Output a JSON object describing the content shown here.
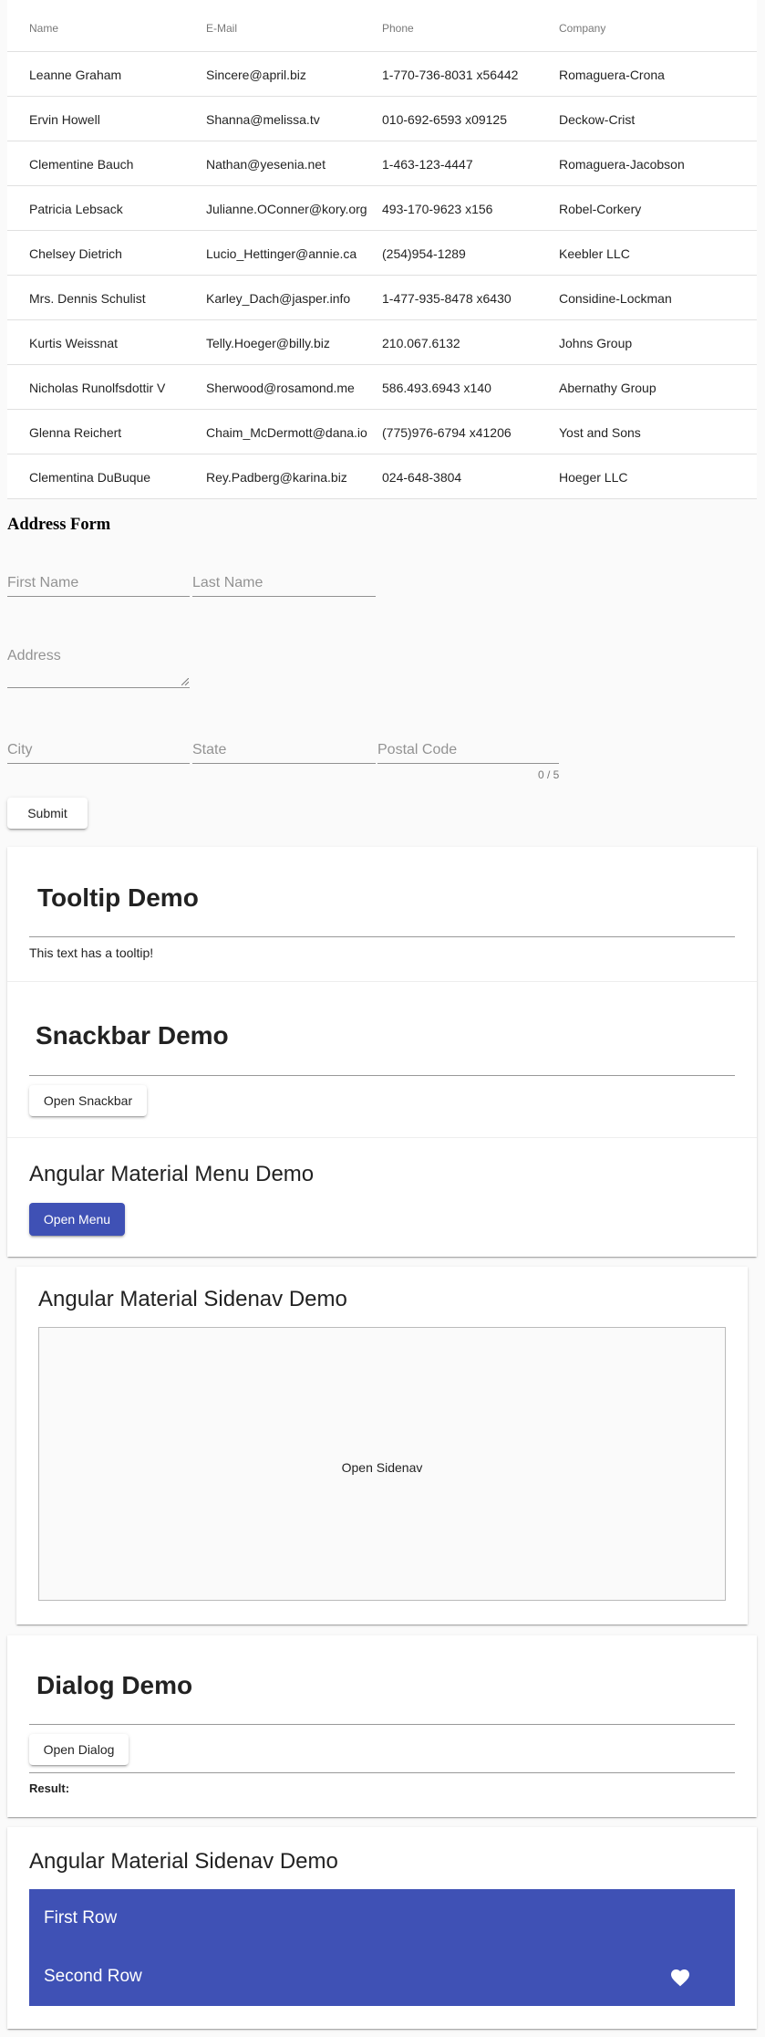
{
  "table": {
    "headers": [
      "Name",
      "E-Mail",
      "Phone",
      "Company"
    ],
    "rows": [
      [
        "Leanne Graham",
        "Sincere@april.biz",
        "1-770-736-8031 x56442",
        "Romaguera-Crona"
      ],
      [
        "Ervin Howell",
        "Shanna@melissa.tv",
        "010-692-6593 x09125",
        "Deckow-Crist"
      ],
      [
        "Clementine Bauch",
        "Nathan@yesenia.net",
        "1-463-123-4447",
        "Romaguera-Jacobson"
      ],
      [
        "Patricia Lebsack",
        "Julianne.OConner@kory.org",
        "493-170-9623 x156",
        "Robel-Corkery"
      ],
      [
        "Chelsey Dietrich",
        "Lucio_Hettinger@annie.ca",
        "(254)954-1289",
        "Keebler LLC"
      ],
      [
        "Mrs. Dennis Schulist",
        "Karley_Dach@jasper.info",
        "1-477-935-8478 x6430",
        "Considine-Lockman"
      ],
      [
        "Kurtis Weissnat",
        "Telly.Hoeger@billy.biz",
        "210.067.6132",
        "Johns Group"
      ],
      [
        "Nicholas Runolfsdottir V",
        "Sherwood@rosamond.me",
        "586.493.6943 x140",
        "Abernathy Group"
      ],
      [
        "Glenna Reichert",
        "Chaim_McDermott@dana.io",
        "(775)976-6794 x41206",
        "Yost and Sons"
      ],
      [
        "Clementina DuBuque",
        "Rey.Padberg@karina.biz",
        "024-648-3804",
        "Hoeger LLC"
      ]
    ]
  },
  "address_form": {
    "title": "Address Form",
    "first_name": "First Name",
    "last_name": "Last Name",
    "address": "Address",
    "city": "City",
    "state": "State",
    "postal_code": "Postal Code",
    "postal_counter": "0 / 5",
    "submit": "Submit"
  },
  "tooltip_demo": {
    "title": "Tooltip Demo",
    "text": "This text has a tooltip!"
  },
  "snackbar_demo": {
    "title": "Snackbar Demo",
    "button": "Open Snackbar"
  },
  "menu_demo": {
    "title": "Angular Material Menu Demo",
    "button": "Open Menu"
  },
  "sidenav_demo": {
    "title": "Angular Material Sidenav Demo",
    "button": "Open Sidenav"
  },
  "dialog_demo": {
    "title": "Dialog Demo",
    "button": "Open Dialog",
    "result_label": "Result:"
  },
  "list_demo": {
    "title": "Angular Material Sidenav Demo",
    "rows": [
      "First Row",
      "Second Row"
    ],
    "icon": "heart-icon"
  },
  "colors": {
    "primary": "#3f51b5"
  }
}
